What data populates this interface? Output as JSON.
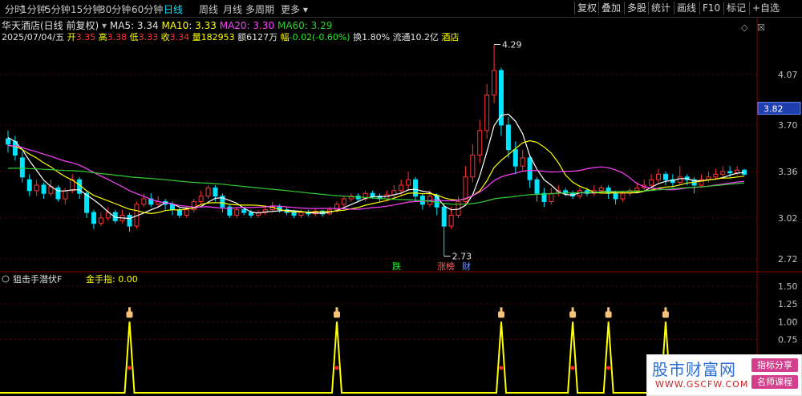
{
  "toolbar": {
    "periods": [
      "分时",
      "1分钟",
      "5分钟",
      "15分钟",
      "30分钟",
      "60分钟",
      "日线",
      "周线",
      "月线",
      "多周期",
      "更多"
    ],
    "active": "日线",
    "right": [
      "复权",
      "叠加",
      "多股",
      "统计",
      "画线",
      "F10",
      "标记",
      "+自选"
    ]
  },
  "stock": {
    "name": "华天酒店(日线 前复权)",
    "ma5": "MA5: 3.34",
    "ma10": "MA10: 3.33",
    "ma20": "MA20: 3.30",
    "ma60": "MA60: 3.29",
    "date": "2025/07/04/五",
    "open_label": "开",
    "open": "3.35",
    "high_label": "高",
    "high": "3.38",
    "low_label": "低",
    "low": "3.33",
    "close_label": "收",
    "close": "3.34",
    "vol_label": "量",
    "vol": "182953",
    "amt_label": "额",
    "amt": "6127万",
    "chg_label": "幅",
    "chg": "-0.02(-0.60%)",
    "turnover": "换1.80%",
    "float": "流通10.2亿",
    "industry": "酒店"
  },
  "colors": {
    "up": "#ff3333",
    "down": "#00e5ff",
    "ma5": "#ffffff",
    "ma10": "#ffff00",
    "ma20": "#ff40ff",
    "ma60": "#33cc33",
    "signal": "#ffff00",
    "price_box": "#1f3fae"
  },
  "markers": {
    "die": "跌",
    "jia": "涨榜",
    "cai": "财",
    "high_label": "4.29",
    "low_label": "2.73"
  },
  "indicator": {
    "name": "狙击手潜伏F",
    "value": "金手指: 0.00",
    "y_ticks": [
      "1.50",
      "1.25",
      "1.00",
      "0.75"
    ],
    "signal_icon": "pointing-hand-icon"
  },
  "watermark": {
    "brand": "股市财富网",
    "url": "WWW.GSCFW.COM",
    "tag1": "指标分享",
    "tag2": "名师课程"
  },
  "chart_data": {
    "type": "candlestick",
    "price_axis_ticks": [
      "4.07",
      "3.70",
      "3.36",
      "3.02",
      "2.72"
    ],
    "current_price_label": "3.82",
    "candles": [
      [
        3.6,
        3.56,
        3.66,
        3.5
      ],
      [
        3.58,
        3.48,
        3.62,
        3.44
      ],
      [
        3.46,
        3.32,
        3.5,
        3.28
      ],
      [
        3.3,
        3.22,
        3.34,
        3.18
      ],
      [
        3.22,
        3.26,
        3.3,
        3.18
      ],
      [
        3.26,
        3.2,
        3.28,
        3.16
      ],
      [
        3.2,
        3.25,
        3.3,
        3.18
      ],
      [
        3.24,
        3.16,
        3.26,
        3.14
      ],
      [
        3.16,
        3.22,
        3.24,
        3.12
      ],
      [
        3.22,
        3.3,
        3.34,
        3.2
      ],
      [
        3.3,
        3.2,
        3.32,
        3.16
      ],
      [
        3.2,
        3.06,
        3.22,
        3.02
      ],
      [
        3.06,
        2.98,
        3.08,
        2.94
      ],
      [
        2.98,
        3.02,
        3.06,
        2.96
      ],
      [
        3.02,
        3.06,
        3.1,
        3.0
      ],
      [
        3.06,
        3.0,
        3.08,
        2.98
      ],
      [
        3.0,
        3.04,
        3.08,
        2.98
      ],
      [
        3.04,
        2.96,
        3.06,
        2.92
      ],
      [
        2.96,
        3.12,
        3.14,
        2.94
      ],
      [
        3.12,
        3.16,
        3.2,
        3.1
      ],
      [
        3.16,
        3.12,
        3.2,
        3.1
      ],
      [
        3.12,
        3.14,
        3.18,
        3.1
      ],
      [
        3.14,
        3.12,
        3.16,
        3.08
      ],
      [
        3.12,
        3.08,
        3.14,
        3.04
      ],
      [
        3.08,
        3.04,
        3.1,
        3.02
      ],
      [
        3.04,
        3.08,
        3.1,
        3.02
      ],
      [
        3.08,
        3.14,
        3.16,
        3.06
      ],
      [
        3.14,
        3.18,
        3.22,
        3.12
      ],
      [
        3.18,
        3.24,
        3.26,
        3.16
      ],
      [
        3.24,
        3.18,
        3.26,
        3.14
      ],
      [
        3.18,
        3.1,
        3.2,
        3.06
      ],
      [
        3.1,
        3.04,
        3.12,
        3.02
      ],
      [
        3.04,
        3.08,
        3.1,
        3.02
      ],
      [
        3.08,
        3.06,
        3.1,
        3.04
      ],
      [
        3.06,
        3.04,
        3.08,
        3.02
      ],
      [
        3.04,
        3.06,
        3.08,
        3.02
      ],
      [
        3.06,
        3.08,
        3.1,
        3.04
      ],
      [
        3.08,
        3.1,
        3.14,
        3.06
      ],
      [
        3.1,
        3.08,
        3.12,
        3.06
      ],
      [
        3.08,
        3.06,
        3.1,
        3.04
      ],
      [
        3.06,
        3.04,
        3.08,
        3.02
      ],
      [
        3.04,
        3.06,
        3.08,
        3.02
      ],
      [
        3.06,
        3.05,
        3.08,
        3.03
      ],
      [
        3.05,
        3.07,
        3.09,
        3.03
      ],
      [
        3.07,
        3.05,
        3.08,
        3.03
      ],
      [
        3.05,
        3.08,
        3.1,
        3.04
      ],
      [
        3.08,
        3.12,
        3.14,
        3.06
      ],
      [
        3.12,
        3.16,
        3.18,
        3.1
      ],
      [
        3.16,
        3.18,
        3.2,
        3.14
      ],
      [
        3.18,
        3.16,
        3.2,
        3.14
      ],
      [
        3.16,
        3.2,
        3.22,
        3.14
      ],
      [
        3.2,
        3.18,
        3.22,
        3.16
      ],
      [
        3.18,
        3.16,
        3.2,
        3.14
      ],
      [
        3.16,
        3.19,
        3.22,
        3.14
      ],
      [
        3.19,
        3.22,
        3.26,
        3.16
      ],
      [
        3.22,
        3.26,
        3.3,
        3.18
      ],
      [
        3.26,
        3.3,
        3.36,
        3.22
      ],
      [
        3.3,
        3.18,
        3.32,
        3.14
      ],
      [
        3.18,
        3.12,
        3.2,
        3.08
      ],
      [
        3.12,
        3.18,
        3.22,
        3.1
      ],
      [
        3.18,
        3.1,
        3.2,
        3.04
      ],
      [
        3.1,
        2.96,
        3.12,
        2.74
      ],
      [
        2.96,
        3.04,
        3.1,
        2.94
      ],
      [
        3.04,
        3.14,
        3.18,
        3.02
      ],
      [
        3.14,
        3.32,
        3.4,
        3.12
      ],
      [
        3.32,
        3.48,
        3.56,
        3.28
      ],
      [
        3.48,
        3.66,
        3.74,
        3.42
      ],
      [
        3.66,
        3.92,
        4.0,
        3.6
      ],
      [
        3.92,
        4.1,
        4.29,
        3.86
      ],
      [
        4.1,
        3.7,
        4.12,
        3.62
      ],
      [
        3.7,
        3.52,
        3.76,
        3.46
      ],
      [
        3.52,
        3.4,
        3.58,
        3.34
      ],
      [
        3.4,
        3.46,
        3.52,
        3.36
      ],
      [
        3.46,
        3.3,
        3.48,
        3.24
      ],
      [
        3.3,
        3.2,
        3.32,
        3.14
      ],
      [
        3.2,
        3.14,
        3.24,
        3.1
      ],
      [
        3.14,
        3.2,
        3.24,
        3.12
      ],
      [
        3.2,
        3.22,
        3.26,
        3.18
      ],
      [
        3.22,
        3.2,
        3.24,
        3.18
      ],
      [
        3.2,
        3.18,
        3.22,
        3.16
      ],
      [
        3.18,
        3.22,
        3.24,
        3.16
      ],
      [
        3.22,
        3.2,
        3.24,
        3.18
      ],
      [
        3.2,
        3.22,
        3.26,
        3.18
      ],
      [
        3.22,
        3.24,
        3.26,
        3.2
      ],
      [
        3.24,
        3.2,
        3.26,
        3.16
      ],
      [
        3.2,
        3.16,
        3.22,
        3.12
      ],
      [
        3.16,
        3.2,
        3.22,
        3.14
      ],
      [
        3.2,
        3.22,
        3.24,
        3.18
      ],
      [
        3.22,
        3.24,
        3.28,
        3.2
      ],
      [
        3.24,
        3.26,
        3.3,
        3.22
      ],
      [
        3.26,
        3.3,
        3.34,
        3.24
      ],
      [
        3.3,
        3.34,
        3.38,
        3.28
      ],
      [
        3.34,
        3.3,
        3.36,
        3.26
      ],
      [
        3.3,
        3.28,
        3.34,
        3.24
      ],
      [
        3.28,
        3.32,
        3.4,
        3.26
      ],
      [
        3.32,
        3.3,
        3.34,
        3.26
      ],
      [
        3.3,
        3.26,
        3.32,
        3.2
      ],
      [
        3.26,
        3.3,
        3.34,
        3.24
      ],
      [
        3.3,
        3.32,
        3.36,
        3.28
      ],
      [
        3.32,
        3.34,
        3.38,
        3.3
      ],
      [
        3.34,
        3.36,
        3.4,
        3.32
      ],
      [
        3.36,
        3.35,
        3.4,
        3.32
      ],
      [
        3.35,
        3.37,
        3.4,
        3.33
      ],
      [
        3.37,
        3.34,
        3.38,
        3.33
      ]
    ],
    "indicator_signals": [
      17,
      46,
      69,
      79,
      84,
      92
    ],
    "indicator_ylim": [
      0,
      1.6
    ]
  }
}
